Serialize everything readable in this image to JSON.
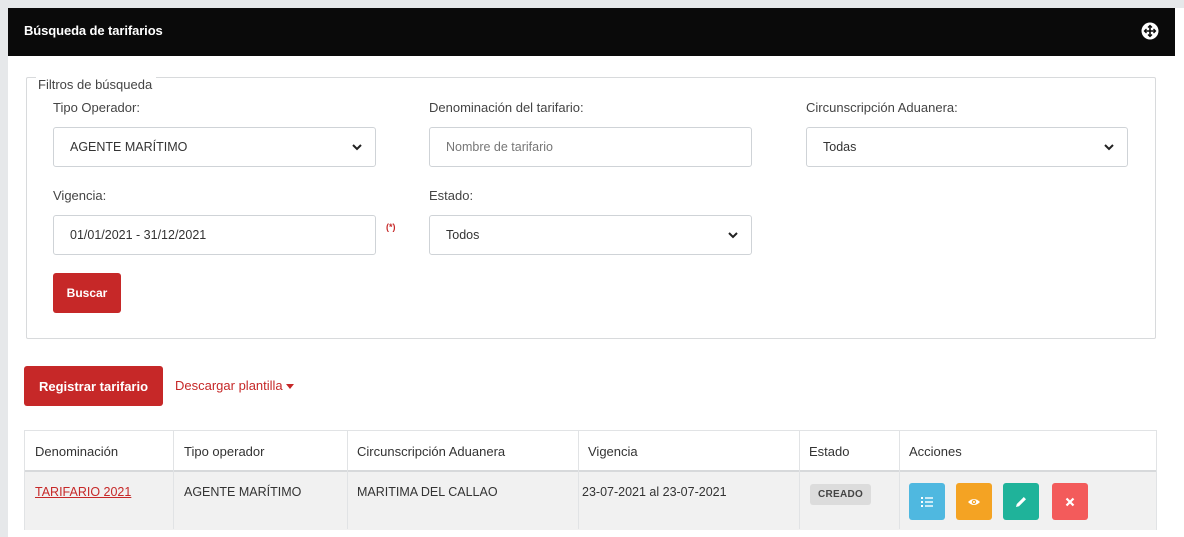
{
  "panel": {
    "title": "Búsqueda de tarifarios"
  },
  "filters": {
    "legend": "Filtros de búsqueda",
    "tipo_operador": {
      "label": "Tipo Operador:",
      "value": "AGENTE MARÍTIMO"
    },
    "denominacion": {
      "label": "Denominación del tarifario:",
      "placeholder": "Nombre de tarifario"
    },
    "circunscripcion": {
      "label": "Circunscripción Aduanera:",
      "value": "Todas"
    },
    "vigencia": {
      "label": "Vigencia:",
      "value": "01/01/2021 - 31/12/2021",
      "required_mark": "(*)"
    },
    "estado": {
      "label": "Estado:",
      "value": "Todos"
    },
    "search_button": "Buscar"
  },
  "actions": {
    "register_button": "Registrar tarifario",
    "download_link": "Descargar plantilla"
  },
  "table": {
    "headers": [
      "Denominación",
      "Tipo operador",
      "Circunscripción Aduanera",
      "Vigencia",
      "Estado",
      "Acciones"
    ],
    "rows": [
      {
        "denominacion": "TARIFARIO 2021",
        "tipo_operador": "AGENTE MARÍTIMO",
        "circunscripcion": "MARITIMA DEL CALLAO",
        "vigencia": "23-07-2021 al 23-07-2021",
        "estado": "CREADO"
      }
    ],
    "action_icons": [
      "list-icon",
      "eye-icon",
      "pencil-icon",
      "close-icon"
    ]
  },
  "colors": {
    "brand_red": "#c62828",
    "header_bg": "#0a0a0a",
    "action_list": "#4fb8e0",
    "action_view": "#f4a323",
    "action_edit": "#1fb39a",
    "action_delete": "#f35b5b"
  }
}
